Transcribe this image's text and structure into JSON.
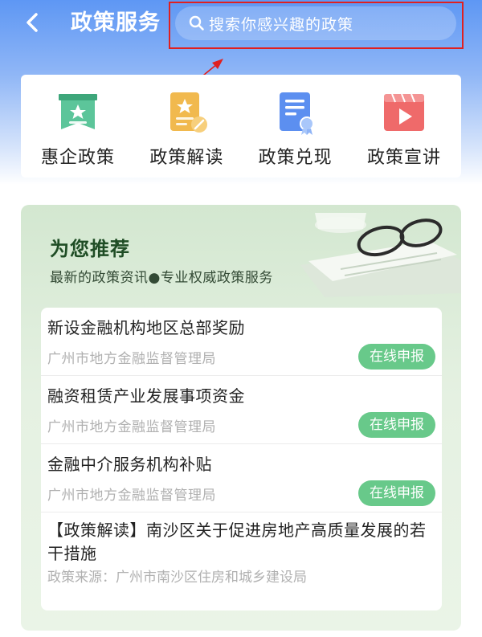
{
  "header": {
    "title": "政策服务",
    "search_placeholder": "搜索你感兴趣的政策"
  },
  "quick_links": [
    {
      "label": "惠企政策",
      "icon": "award-icon",
      "color": "#5cc59a"
    },
    {
      "label": "政策解读",
      "icon": "doc-star-icon",
      "color": "#f1b94e"
    },
    {
      "label": "政策兑现",
      "icon": "certificate-icon",
      "color": "#5c8ff0"
    },
    {
      "label": "政策宣讲",
      "icon": "video-icon",
      "color": "#ef6a6a"
    }
  ],
  "recommend": {
    "title": "为您推荐",
    "subtitle": "最新的政策资讯●专业权威政策服务",
    "items": [
      {
        "title": "新设金融机构地区总部奖励",
        "org": "广州市地方金融监督管理局",
        "action": "在线申报"
      },
      {
        "title": "融资租赁产业发展事项资金",
        "org": "广州市地方金融监督管理局",
        "action": "在线申报"
      },
      {
        "title": "金融中介服务机构补贴",
        "org": "广州市地方金融监督管理局",
        "action": "在线申报"
      }
    ],
    "article": {
      "title": "【政策解读】南沙区关于促进房地产高质量发展的若干措施",
      "source": "政策来源：广州市南沙区住房和城乡建设局"
    }
  },
  "colors": {
    "accent_blue": "#5e97f4",
    "apply_green": "#68c98a",
    "highlight_red": "#e02020"
  }
}
